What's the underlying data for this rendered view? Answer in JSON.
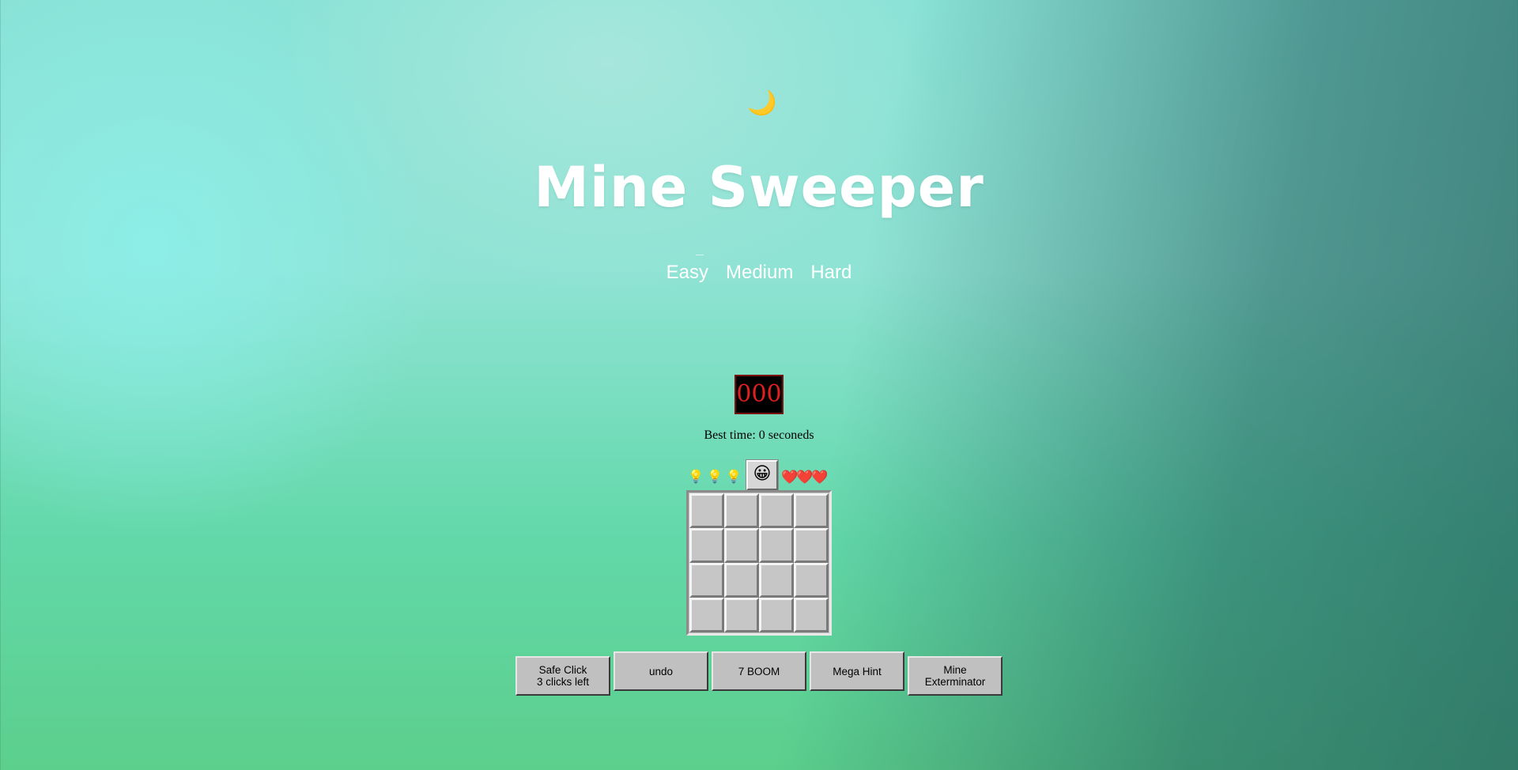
{
  "header": {
    "theme_icon": "crescent-moon-icon",
    "theme_glyph": "🌙",
    "title": "Mine Sweeper"
  },
  "levels": [
    {
      "label": "Easy",
      "active": true
    },
    {
      "label": "Medium",
      "active": false
    },
    {
      "label": "Hard",
      "active": false
    }
  ],
  "game": {
    "timer": "000",
    "best_time": "Best time: 0 seconeds",
    "hints": [
      {
        "icon": "lightbulb-icon",
        "glyph": "💡"
      },
      {
        "icon": "lightbulb-icon",
        "glyph": "💡"
      },
      {
        "icon": "lightbulb-icon",
        "glyph": "💡"
      }
    ],
    "smiley_icon": "smiley-face-icon",
    "smiley_glyph": "😀",
    "lives_icon": "heart-icon",
    "lives_glyphs": "❤️❤️❤️",
    "lives_count": 3,
    "board": {
      "rows": 4,
      "cols": 4,
      "state": "all-unrevealed"
    }
  },
  "actions": {
    "safe_click_label": "Safe Click",
    "safe_click_sub": "3 clicks left",
    "undo_label": "undo",
    "seven_boom_label": "7 BOOM",
    "mega_hint_label": "Mega Hint",
    "exterminator_label_1": "Mine",
    "exterminator_label_2": "Exterminator"
  },
  "colors": {
    "timer_bg": "#000000",
    "timer_text": "#e02020",
    "cell": "#c6c6c6",
    "button": "#c0c0c0"
  }
}
